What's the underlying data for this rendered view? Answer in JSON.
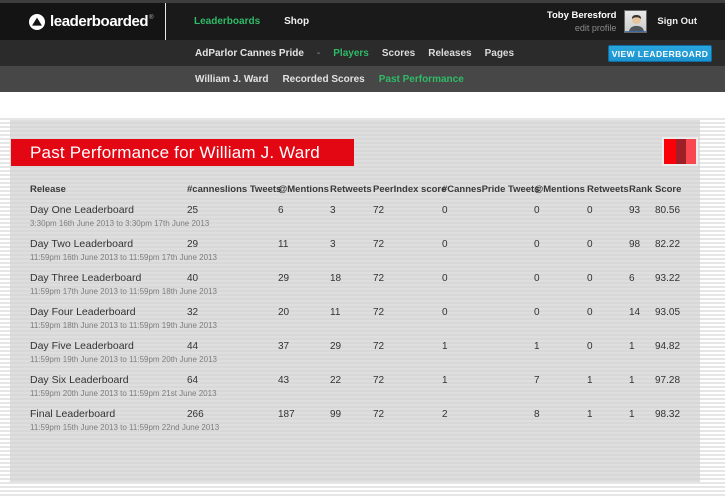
{
  "navbar": {
    "logo": {
      "text": "leaderboarded",
      "registered": "®"
    },
    "items": [
      {
        "label": "Leaderboards",
        "active": true
      },
      {
        "label": "Shop",
        "active": false
      }
    ],
    "user": {
      "name": "Toby Beresford",
      "edit_profile": "edit profile",
      "sign_out": "Sign Out"
    }
  },
  "subnav": {
    "board_name": "AdParlor Cannes Pride",
    "divider": "-",
    "items": [
      {
        "label": "Players",
        "active": true
      },
      {
        "label": "Scores",
        "active": false
      },
      {
        "label": "Releases",
        "active": false
      },
      {
        "label": "Pages",
        "active": false
      }
    ],
    "view_leaderboard_button": "VIEW LEADERBOARD",
    "button_color": "#1b93cf"
  },
  "player_nav": {
    "items": [
      {
        "label": "William J. Ward",
        "active": false
      },
      {
        "label": "Recorded Scores",
        "active": false
      },
      {
        "label": "Past Performance",
        "active": true
      }
    ]
  },
  "main": {
    "title": "Past Performance for William J. Ward",
    "title_bg": "#e30613",
    "accent_green": "#2fbb68",
    "table": {
      "columns": [
        "Release",
        "#canneslions Tweets",
        "@Mentions",
        "Retweets",
        "PeerIndex score",
        "#CannesPride Tweets",
        "@Mentions",
        "Retweets",
        "Rank",
        "Score"
      ],
      "rows": [
        {
          "release": "Day One Leaderboard",
          "period": "3:30pm 16th June 2013 to 3:30pm 17th June 2013",
          "values": [
            "25",
            "6",
            "3",
            "72",
            "0",
            "0",
            "0",
            "93",
            "80.56"
          ]
        },
        {
          "release": "Day Two Leaderboard",
          "period": "11:59pm 16th June 2013 to 11:59pm 17th June 2013",
          "values": [
            "29",
            "11",
            "3",
            "72",
            "0",
            "0",
            "0",
            "98",
            "82.22"
          ]
        },
        {
          "release": "Day Three Leaderboard",
          "period": "11:59pm 17th June 2013 to 11:59pm 18th June 2013",
          "values": [
            "40",
            "29",
            "18",
            "72",
            "0",
            "0",
            "0",
            "6",
            "93.22"
          ]
        },
        {
          "release": "Day Four Leaderboard",
          "period": "11:59pm 18th June 2013 to 11:59pm 19th June 2013",
          "values": [
            "32",
            "20",
            "11",
            "72",
            "0",
            "0",
            "0",
            "14",
            "93.05"
          ]
        },
        {
          "release": "Day Five Leaderboard",
          "period": "11:59pm 19th June 2013 to 11:59pm 20th June 2013",
          "values": [
            "44",
            "37",
            "29",
            "72",
            "1",
            "1",
            "0",
            "1",
            "94.82"
          ]
        },
        {
          "release": "Day Six Leaderboard",
          "period": "11:59pm 20th June 2013 to 11:59pm 21st June 2013",
          "values": [
            "64",
            "43",
            "22",
            "72",
            "1",
            "7",
            "1",
            "1",
            "97.28"
          ]
        },
        {
          "release": "Final Leaderboard",
          "period": "11:59pm 15th June 2013 to 11:59pm 22nd June 2013",
          "values": [
            "266",
            "187",
            "99",
            "72",
            "2",
            "8",
            "1",
            "1",
            "98.32"
          ]
        }
      ]
    }
  }
}
